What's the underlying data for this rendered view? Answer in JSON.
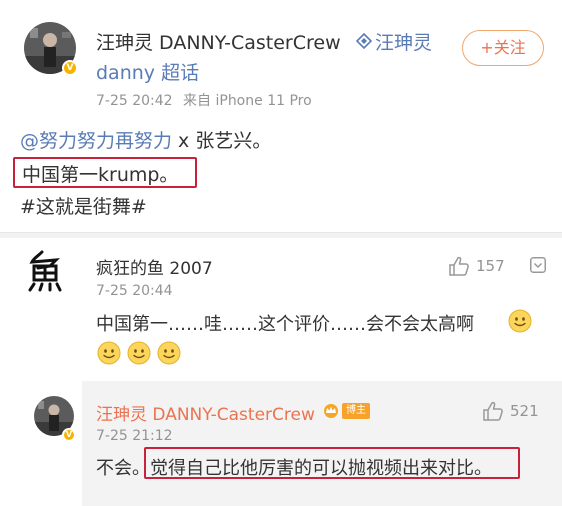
{
  "post": {
    "author": "汪珅灵 DANNY-CasterCrew",
    "super_topic": "汪珅灵",
    "super_topic_suffix": "danny 超话",
    "time": "7-25 20:42",
    "source": "来自 iPhone 11 Pro",
    "follow_label": "+关注",
    "mention": "@努力努力再努力",
    "mention_sep": " x 张艺兴。",
    "line2": "中国第一krump。",
    "hashtag": "#这就是街舞#"
  },
  "comment": {
    "author": "疯狂的鱼 2007",
    "time": "7-25 20:44",
    "likes": "157",
    "text": "中国第一……哇……这个评价……会不会太高啊"
  },
  "reply": {
    "author": "汪珅灵 DANNY-CasterCrew",
    "badge": "博主",
    "time": "7-25 21:12",
    "likes": "521",
    "text_prefix": "不会。",
    "text_highlight": "觉得自己比他厉害的可以抛视频出来对比。"
  },
  "colors": {
    "accent_orange": "#eb7350",
    "link_blue": "#5a7cb6",
    "highlight_red": "#c8213c",
    "meta_gray": "#939393"
  }
}
